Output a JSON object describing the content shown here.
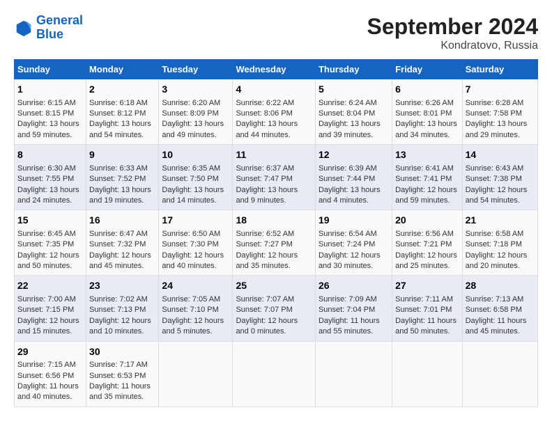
{
  "logo": {
    "line1": "General",
    "line2": "Blue"
  },
  "title": "September 2024",
  "location": "Kondratovo, Russia",
  "header": {
    "accent_color": "#1565c0"
  },
  "days_of_week": [
    "Sunday",
    "Monday",
    "Tuesday",
    "Wednesday",
    "Thursday",
    "Friday",
    "Saturday"
  ],
  "weeks": [
    [
      {
        "day": "1",
        "sunrise": "Sunrise: 6:15 AM",
        "sunset": "Sunset: 8:15 PM",
        "daylight": "Daylight: 13 hours and 59 minutes."
      },
      {
        "day": "2",
        "sunrise": "Sunrise: 6:18 AM",
        "sunset": "Sunset: 8:12 PM",
        "daylight": "Daylight: 13 hours and 54 minutes."
      },
      {
        "day": "3",
        "sunrise": "Sunrise: 6:20 AM",
        "sunset": "Sunset: 8:09 PM",
        "daylight": "Daylight: 13 hours and 49 minutes."
      },
      {
        "day": "4",
        "sunrise": "Sunrise: 6:22 AM",
        "sunset": "Sunset: 8:06 PM",
        "daylight": "Daylight: 13 hours and 44 minutes."
      },
      {
        "day": "5",
        "sunrise": "Sunrise: 6:24 AM",
        "sunset": "Sunset: 8:04 PM",
        "daylight": "Daylight: 13 hours and 39 minutes."
      },
      {
        "day": "6",
        "sunrise": "Sunrise: 6:26 AM",
        "sunset": "Sunset: 8:01 PM",
        "daylight": "Daylight: 13 hours and 34 minutes."
      },
      {
        "day": "7",
        "sunrise": "Sunrise: 6:28 AM",
        "sunset": "Sunset: 7:58 PM",
        "daylight": "Daylight: 13 hours and 29 minutes."
      }
    ],
    [
      {
        "day": "8",
        "sunrise": "Sunrise: 6:30 AM",
        "sunset": "Sunset: 7:55 PM",
        "daylight": "Daylight: 13 hours and 24 minutes."
      },
      {
        "day": "9",
        "sunrise": "Sunrise: 6:33 AM",
        "sunset": "Sunset: 7:52 PM",
        "daylight": "Daylight: 13 hours and 19 minutes."
      },
      {
        "day": "10",
        "sunrise": "Sunrise: 6:35 AM",
        "sunset": "Sunset: 7:50 PM",
        "daylight": "Daylight: 13 hours and 14 minutes."
      },
      {
        "day": "11",
        "sunrise": "Sunrise: 6:37 AM",
        "sunset": "Sunset: 7:47 PM",
        "daylight": "Daylight: 13 hours and 9 minutes."
      },
      {
        "day": "12",
        "sunrise": "Sunrise: 6:39 AM",
        "sunset": "Sunset: 7:44 PM",
        "daylight": "Daylight: 13 hours and 4 minutes."
      },
      {
        "day": "13",
        "sunrise": "Sunrise: 6:41 AM",
        "sunset": "Sunset: 7:41 PM",
        "daylight": "Daylight: 12 hours and 59 minutes."
      },
      {
        "day": "14",
        "sunrise": "Sunrise: 6:43 AM",
        "sunset": "Sunset: 7:38 PM",
        "daylight": "Daylight: 12 hours and 54 minutes."
      }
    ],
    [
      {
        "day": "15",
        "sunrise": "Sunrise: 6:45 AM",
        "sunset": "Sunset: 7:35 PM",
        "daylight": "Daylight: 12 hours and 50 minutes."
      },
      {
        "day": "16",
        "sunrise": "Sunrise: 6:47 AM",
        "sunset": "Sunset: 7:32 PM",
        "daylight": "Daylight: 12 hours and 45 minutes."
      },
      {
        "day": "17",
        "sunrise": "Sunrise: 6:50 AM",
        "sunset": "Sunset: 7:30 PM",
        "daylight": "Daylight: 12 hours and 40 minutes."
      },
      {
        "day": "18",
        "sunrise": "Sunrise: 6:52 AM",
        "sunset": "Sunset: 7:27 PM",
        "daylight": "Daylight: 12 hours and 35 minutes."
      },
      {
        "day": "19",
        "sunrise": "Sunrise: 6:54 AM",
        "sunset": "Sunset: 7:24 PM",
        "daylight": "Daylight: 12 hours and 30 minutes."
      },
      {
        "day": "20",
        "sunrise": "Sunrise: 6:56 AM",
        "sunset": "Sunset: 7:21 PM",
        "daylight": "Daylight: 12 hours and 25 minutes."
      },
      {
        "day": "21",
        "sunrise": "Sunrise: 6:58 AM",
        "sunset": "Sunset: 7:18 PM",
        "daylight": "Daylight: 12 hours and 20 minutes."
      }
    ],
    [
      {
        "day": "22",
        "sunrise": "Sunrise: 7:00 AM",
        "sunset": "Sunset: 7:15 PM",
        "daylight": "Daylight: 12 hours and 15 minutes."
      },
      {
        "day": "23",
        "sunrise": "Sunrise: 7:02 AM",
        "sunset": "Sunset: 7:13 PM",
        "daylight": "Daylight: 12 hours and 10 minutes."
      },
      {
        "day": "24",
        "sunrise": "Sunrise: 7:05 AM",
        "sunset": "Sunset: 7:10 PM",
        "daylight": "Daylight: 12 hours and 5 minutes."
      },
      {
        "day": "25",
        "sunrise": "Sunrise: 7:07 AM",
        "sunset": "Sunset: 7:07 PM",
        "daylight": "Daylight: 12 hours and 0 minutes."
      },
      {
        "day": "26",
        "sunrise": "Sunrise: 7:09 AM",
        "sunset": "Sunset: 7:04 PM",
        "daylight": "Daylight: 11 hours and 55 minutes."
      },
      {
        "day": "27",
        "sunrise": "Sunrise: 7:11 AM",
        "sunset": "Sunset: 7:01 PM",
        "daylight": "Daylight: 11 hours and 50 minutes."
      },
      {
        "day": "28",
        "sunrise": "Sunrise: 7:13 AM",
        "sunset": "Sunset: 6:58 PM",
        "daylight": "Daylight: 11 hours and 45 minutes."
      }
    ],
    [
      {
        "day": "29",
        "sunrise": "Sunrise: 7:15 AM",
        "sunset": "Sunset: 6:56 PM",
        "daylight": "Daylight: 11 hours and 40 minutes."
      },
      {
        "day": "30",
        "sunrise": "Sunrise: 7:17 AM",
        "sunset": "Sunset: 6:53 PM",
        "daylight": "Daylight: 11 hours and 35 minutes."
      },
      {
        "day": "",
        "sunrise": "",
        "sunset": "",
        "daylight": ""
      },
      {
        "day": "",
        "sunrise": "",
        "sunset": "",
        "daylight": ""
      },
      {
        "day": "",
        "sunrise": "",
        "sunset": "",
        "daylight": ""
      },
      {
        "day": "",
        "sunrise": "",
        "sunset": "",
        "daylight": ""
      },
      {
        "day": "",
        "sunrise": "",
        "sunset": "",
        "daylight": ""
      }
    ]
  ]
}
